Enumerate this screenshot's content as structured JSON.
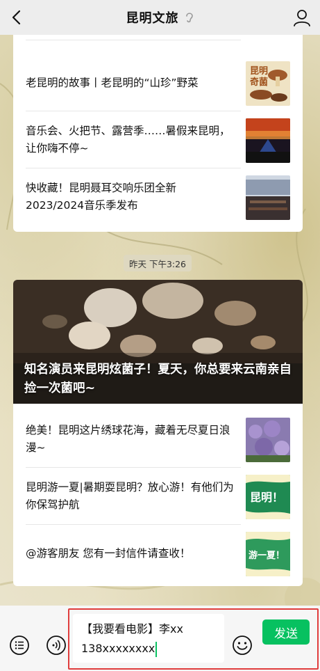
{
  "header": {
    "title": "昆明文旅"
  },
  "top_card": {
    "items": [
      {
        "title": "老昆明的故事丨老昆明的“山珍”野菜"
      },
      {
        "title": "音乐会、火把节、露营季……暑假来昆明，让你嗨不停~"
      },
      {
        "title": "快收藏！昆明聂耳交响乐团全新2023/2024音乐季发布"
      }
    ]
  },
  "timestamp": "昨天 下午3:26",
  "second_card": {
    "hero_title": "知名演员来昆明炫菌子！夏天，你总要来云南亲自捡一次菌吧~",
    "items": [
      {
        "title": "绝美！昆明这片绣球花海，藏着无尽夏日浪漫~"
      },
      {
        "title": "昆明游一夏|暑期耍昆明？放心游！有他们为你保驾护航"
      },
      {
        "title": "@游客朋友 您有一封信件请查收！"
      }
    ]
  },
  "thumbs": {
    "mushroom_label_1": "昆明",
    "mushroom_label_2": "奇菌",
    "green1_label": "昆明！",
    "green2_label": "游一夏！"
  },
  "input": {
    "line1": "【我要看电影】李xx",
    "line2": "138xxxxxxxx"
  },
  "send_label": "发送",
  "colors": {
    "accent_green": "#07c160",
    "highlight_red": "#e03c3c"
  }
}
